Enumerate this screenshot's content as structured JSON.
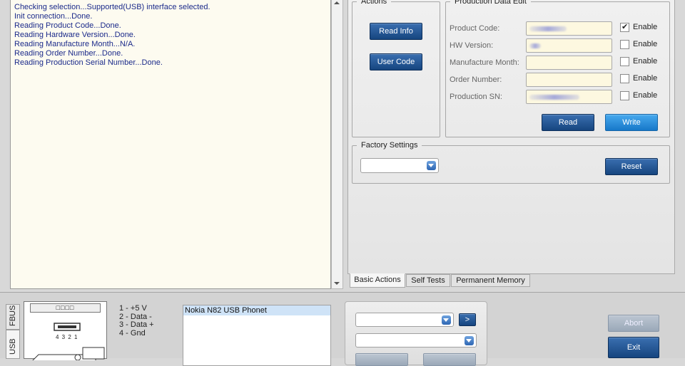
{
  "log": {
    "lines": [
      "Checking selection...Supported(USB) interface selected.",
      "Init connection...Done.",
      "Reading Product Code...Done.",
      "Reading Hardware Version...Done.",
      "Reading Manufacture Month...N/A.",
      "Reading Order Number...Done.",
      "Reading Production Serial Number...Done."
    ]
  },
  "actions": {
    "legend": "Actions",
    "read_info": "Read Info",
    "user_code": "User Code"
  },
  "production_data": {
    "legend": "Production Data Edit",
    "rows": [
      {
        "label": "Product Code:",
        "value": "",
        "check_label": "Enable",
        "checked": true
      },
      {
        "label": "HW Version:",
        "value": "",
        "check_label": "Enable",
        "checked": false
      },
      {
        "label": "Manufacture Month:",
        "value": "",
        "check_label": "Enable",
        "checked": false
      },
      {
        "label": "Order Number:",
        "value": "",
        "check_label": "Enable",
        "checked": false
      },
      {
        "label": "Production SN:",
        "value": "",
        "check_label": "Enable",
        "checked": false
      }
    ],
    "read": "Read",
    "write": "Write"
  },
  "factory": {
    "legend": "Factory Settings",
    "selected": "",
    "reset": "Reset"
  },
  "tabs": [
    "Basic Actions",
    "Self Tests",
    "Permanent Memory"
  ],
  "connection": {
    "vtabs": [
      "FBUS",
      "USB"
    ],
    "port_label": "4 3 2 1",
    "pins": [
      "1 - +5 V",
      "2 - Data -",
      "3 - Data +",
      "4 - Gnd"
    ],
    "devices": [
      "Nokia N82 USB Phonet"
    ],
    "go_button": ">",
    "abort": "Abort",
    "exit": "Exit"
  },
  "colors": {
    "log_text": "#1b2a8a",
    "log_bg": "#fdfbf0",
    "button_dark": "#16457f",
    "button_light": "#1778c9",
    "field_bg": "#fdf8e0"
  }
}
